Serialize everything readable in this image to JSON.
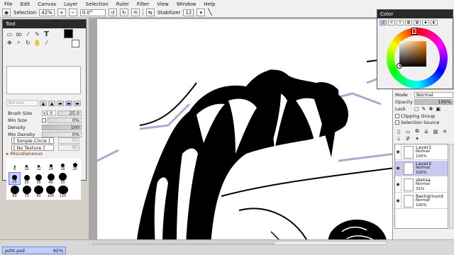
{
  "menu": [
    "File",
    "Edit",
    "Canvas",
    "Layer",
    "Selection",
    "Ruler",
    "Filter",
    "View",
    "Window",
    "Help"
  ],
  "toolbar": {
    "selection_label": "Selection",
    "zoom": "42%",
    "rotation": "0.0°",
    "stabilizer_label": "Stabilizer",
    "stabilizer_value": "12"
  },
  "tool_panel": {
    "title": "Tool",
    "blend_mode": "Normal",
    "brush_size_label": "Brush Size",
    "brush_size_mult": "x1.0",
    "brush_size_value": "25.0",
    "min_size_label": "Min Size",
    "min_size_value": "0%",
    "density_label": "Density",
    "density_value": "100",
    "min_density_label": "Min Density",
    "min_density_value": "0%",
    "shape": "[ Simple Circle ]",
    "shape_value": "50",
    "texture": "[ No Texture ]",
    "texture_value": "95",
    "misc_label": "Miscellaneous",
    "brush_sizes": [
      [
        "8",
        "10",
        "12",
        "14",
        "16",
        "20"
      ],
      [
        "25",
        "30",
        "35",
        "40",
        "50"
      ],
      [
        "60",
        "70",
        "80",
        "100",
        "120"
      ]
    ],
    "selected_size": "25"
  },
  "color_panel": {
    "title": "Color",
    "current_color": "#d07a28"
  },
  "layer_panel": {
    "mode_label": "Mode",
    "mode_value": "Normal",
    "opacity_label": "Opacity",
    "opacity_value": "100%",
    "lock_label": "Lock",
    "clipping_label": "Clipping Group",
    "selection_source_label": "Selection Source",
    "layers": [
      {
        "name": "Layer1",
        "mode": "Normal",
        "opacity": "100%"
      },
      {
        "name": "Layer2",
        "mode": "Normal",
        "opacity": "100%"
      },
      {
        "name": "sketsa",
        "mode": "Normal",
        "opacity": "31%"
      },
      {
        "name": "Background",
        "mode": "Normal",
        "opacity": "100%"
      }
    ]
  },
  "status": {
    "doc_name": "psht.psd",
    "doc_zoom": "42%"
  },
  "accents": {
    "selected_layer": "#c8c8f0",
    "doc_tab": "#c3ccff",
    "selected_preset": "#b8c4ff"
  }
}
